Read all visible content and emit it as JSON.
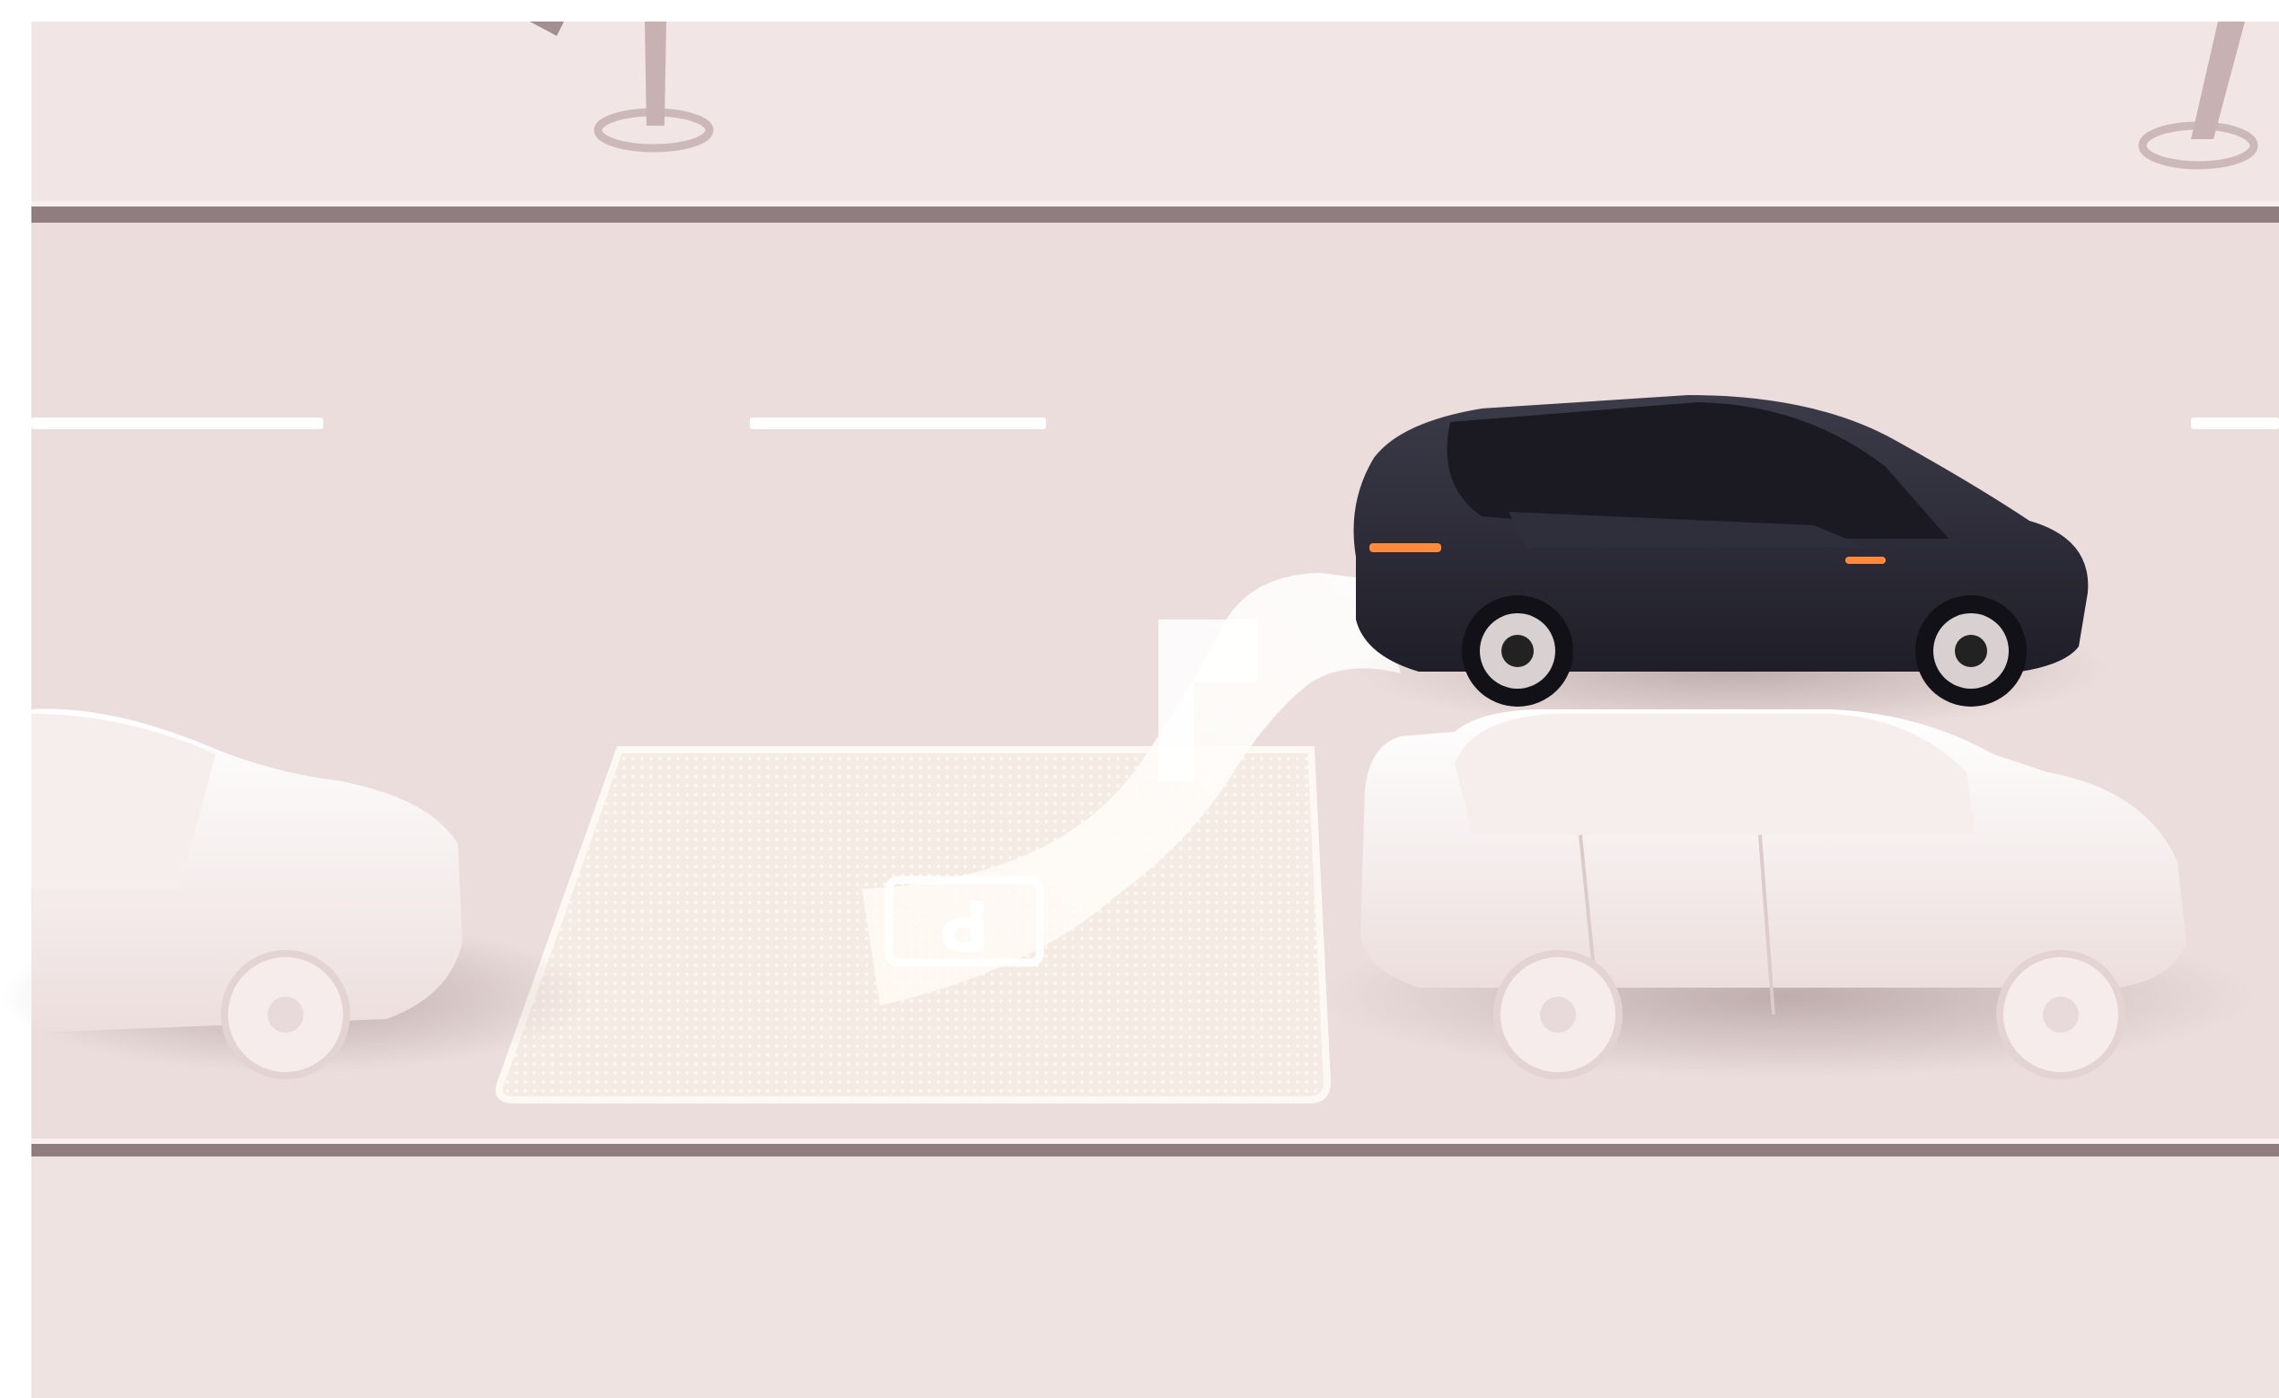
{
  "scene": {
    "kind": "illustration",
    "parking_sign": {
      "glyph": "P",
      "orientation": "rotated-180"
    },
    "ego_car": {
      "color": "#2b2a36",
      "style": "dark coupe"
    },
    "parked_cars": {
      "color": "#f3e8e6",
      "count": 2
    },
    "colors": {
      "background": "#efe3e2",
      "road": "#eadddc",
      "curb": "#8d7b7d",
      "lane_marking": "#ffffff",
      "path_glow": "#fff7ee",
      "tail_light": "#ff8a3d"
    }
  }
}
